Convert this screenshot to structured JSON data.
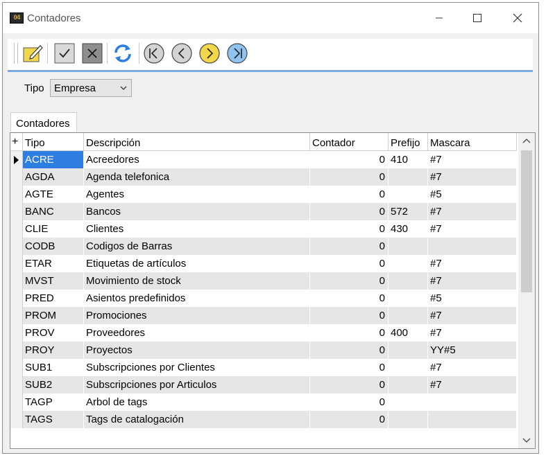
{
  "window": {
    "title": "Contadores",
    "icon": "counter-app-icon"
  },
  "toolbar": {
    "buttons": [
      "edit",
      "confirm",
      "cancel",
      "refresh",
      "first",
      "previous",
      "next",
      "last"
    ]
  },
  "filter": {
    "label": "Tipo",
    "value": "Empresa"
  },
  "tab": {
    "label": "Contadores"
  },
  "grid": {
    "indicator_header": "+",
    "columns": [
      "Tipo",
      "Descripción",
      "Contador",
      "Prefijo",
      "Mascara"
    ],
    "selected_row": 0,
    "rows": [
      {
        "tipo": "ACRE",
        "descripcion": "Acreedores",
        "contador": "0",
        "prefijo": "410",
        "mascara": "#7"
      },
      {
        "tipo": "AGDA",
        "descripcion": "Agenda telefonica",
        "contador": "0",
        "prefijo": "",
        "mascara": "#7"
      },
      {
        "tipo": "AGTE",
        "descripcion": "Agentes",
        "contador": "0",
        "prefijo": "",
        "mascara": "#5"
      },
      {
        "tipo": "BANC",
        "descripcion": "Bancos",
        "contador": "0",
        "prefijo": "572",
        "mascara": "#7"
      },
      {
        "tipo": "CLIE",
        "descripcion": "Clientes",
        "contador": "0",
        "prefijo": "430",
        "mascara": "#7"
      },
      {
        "tipo": "CODB",
        "descripcion": "Codigos de Barras",
        "contador": "0",
        "prefijo": "",
        "mascara": ""
      },
      {
        "tipo": "ETAR",
        "descripcion": "Etiquetas de artículos",
        "contador": "0",
        "prefijo": "",
        "mascara": "#7"
      },
      {
        "tipo": "MVST",
        "descripcion": "Movimiento de stock",
        "contador": "0",
        "prefijo": "",
        "mascara": "#7"
      },
      {
        "tipo": "PRED",
        "descripcion": "Asientos predefinidos",
        "contador": "0",
        "prefijo": "",
        "mascara": "#5"
      },
      {
        "tipo": "PROM",
        "descripcion": "Promociones",
        "contador": "0",
        "prefijo": "",
        "mascara": "#7"
      },
      {
        "tipo": "PROV",
        "descripcion": "Proveedores",
        "contador": "0",
        "prefijo": "400",
        "mascara": "#7"
      },
      {
        "tipo": "PROY",
        "descripcion": "Proyectos",
        "contador": "0",
        "prefijo": "",
        "mascara": "YY#5"
      },
      {
        "tipo": "SUB1",
        "descripcion": "Subscripciones por Clientes",
        "contador": "0",
        "prefijo": "",
        "mascara": "#7"
      },
      {
        "tipo": "SUB2",
        "descripcion": "Subscripciones por Articulos",
        "contador": "0",
        "prefijo": "",
        "mascara": "#7"
      },
      {
        "tipo": "TAGP",
        "descripcion": "Arbol de tags",
        "contador": "0",
        "prefijo": "",
        "mascara": ""
      },
      {
        "tipo": "TAGS",
        "descripcion": "Tags de catalogación",
        "contador": "0",
        "prefijo": "",
        "mascara": ""
      }
    ]
  },
  "colors": {
    "accent": "#7aaadf",
    "selection": "#2e7de1",
    "row_alt": "#e6e6e6",
    "nav_active": "#f2d64b",
    "nav_last": "#8fc3f0"
  }
}
